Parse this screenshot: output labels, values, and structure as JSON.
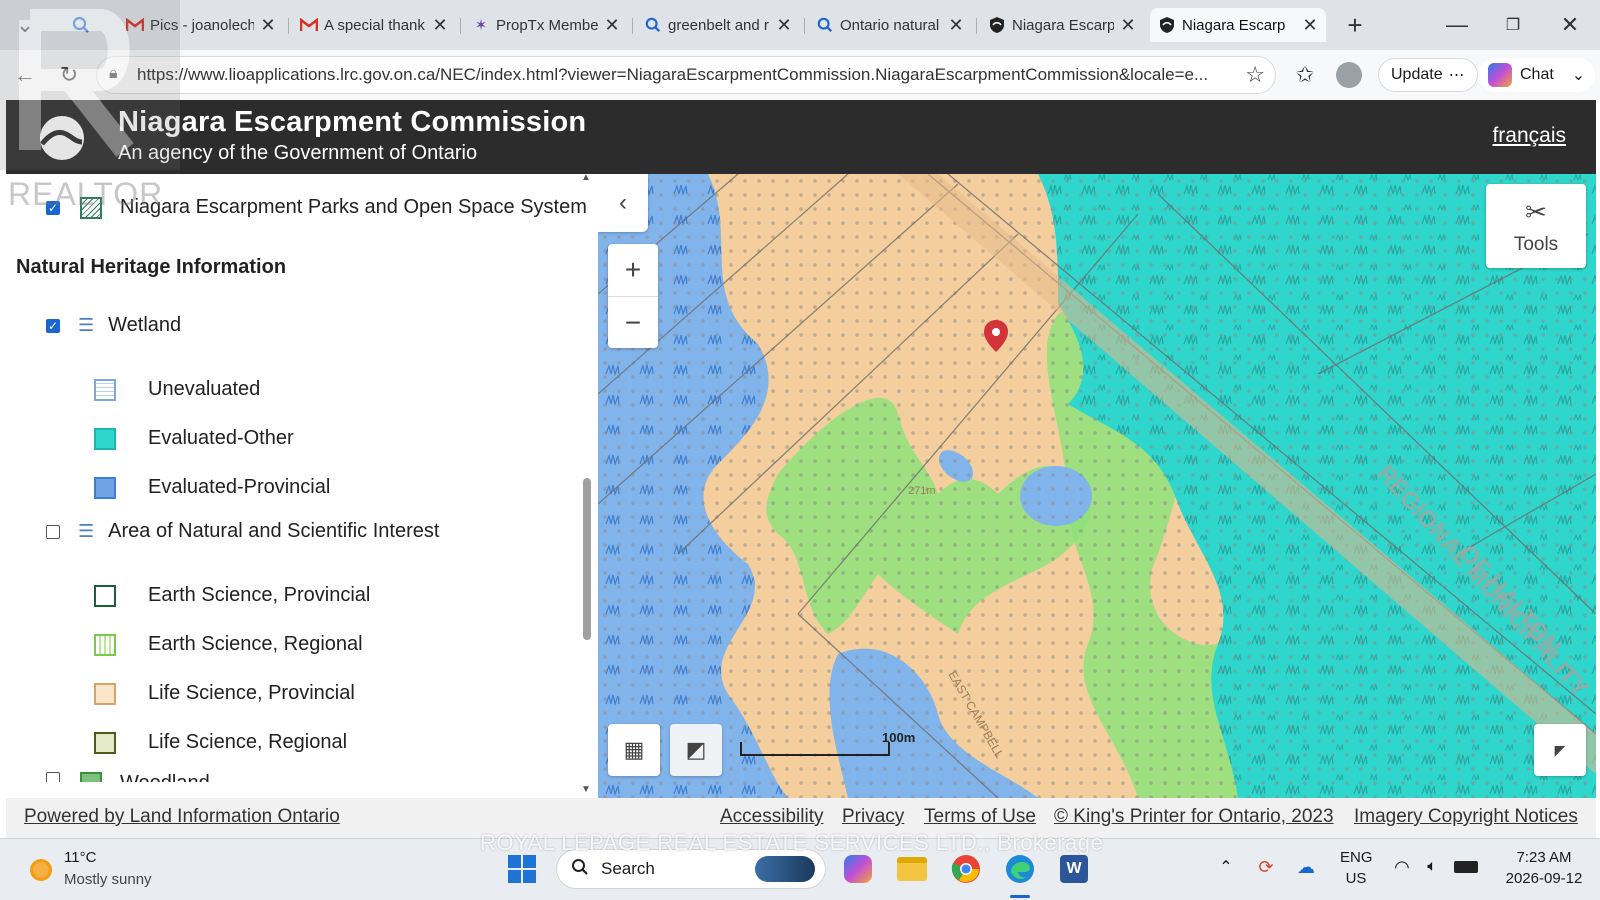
{
  "tabs": [
    {
      "title": "Pics - joanolech",
      "favicon": "gmail-icon",
      "color": "#d93025"
    },
    {
      "title": "A special thank",
      "favicon": "gmail-icon",
      "color": "#d93025"
    },
    {
      "title": "PropTx Membe",
      "favicon": "proptx-icon",
      "color": "#6b4aa5"
    },
    {
      "title": "greenbelt and r",
      "favicon": "search-icon",
      "color": "#1a66d1"
    },
    {
      "title": "Ontario natural",
      "favicon": "search-icon",
      "color": "#1a66d1"
    },
    {
      "title": "Niagara Escarp",
      "favicon": "shield-icon",
      "color": "#222"
    },
    {
      "title": "Niagara Escarp",
      "favicon": "shield-icon",
      "color": "#222"
    }
  ],
  "browser": {
    "url": "https://www.lioapplications.lrc.gov.on.ca/NEC/index.html?viewer=NiagaraEscarpmentCommission.NiagaraEscarpmentCommission&locale=e...",
    "update_label": "Update",
    "chat_label": "Chat"
  },
  "header": {
    "title": "Niagara Escarpment Commission",
    "subtitle": "An agency of the Government of Ontario",
    "language_link": "français"
  },
  "panel": {
    "top_item": "Niagara Escarpment Parks and Open Space System",
    "section_heading": "Natural Heritage Information",
    "wetland": {
      "label": "Wetland",
      "checked": true,
      "children": [
        "Unevaluated",
        "Evaluated-Other",
        "Evaluated-Provincial"
      ]
    },
    "ansi": {
      "label": "Area of Natural and Scientific Interest",
      "checked": false,
      "children": [
        "Earth Science, Provincial",
        "Earth Science, Regional",
        "Life Science, Provincial",
        "Life Science, Regional"
      ]
    },
    "partial_item": "Woodland"
  },
  "map": {
    "tools_label": "Tools",
    "scale_label": "100m",
    "area_label_1": "REGIONAL MUNICIPALITY",
    "area_label_2": "OF HALTON",
    "small_label": "271m",
    "road_label": "EAST CAMPBELL"
  },
  "footer": {
    "powered": "Powered by Land Information Ontario",
    "links": [
      "Accessibility",
      "Privacy",
      "Terms of Use",
      "© King's Printer for Ontario, 2023",
      "Imagery Copyright Notices"
    ]
  },
  "taskbar": {
    "temperature": "11°C",
    "weather": "Mostly sunny",
    "search_label": "Search",
    "lang_top": "ENG",
    "lang_bottom": "US",
    "time": "7:23 AM",
    "date": "2026-09-12"
  },
  "watermark": {
    "top": "REALTOR",
    "bottom": "ROYAL LEPAGE REAL ESTATE SERVICES LTD., Brokerage"
  }
}
